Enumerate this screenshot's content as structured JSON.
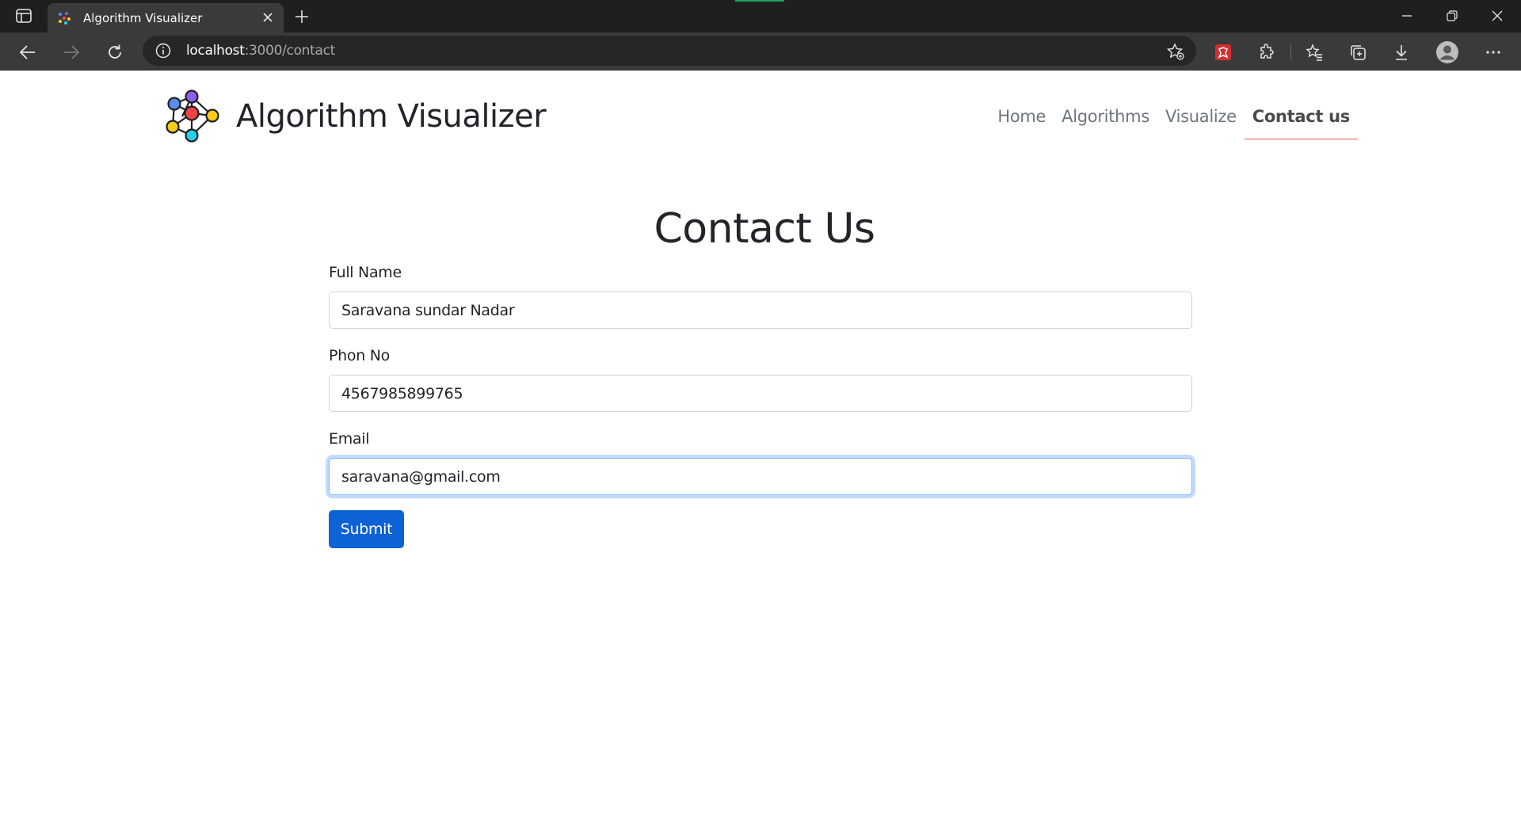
{
  "browser": {
    "tab_title": "Algorithm Visualizer",
    "url_host": "localhost",
    "url_path": ":3000/contact"
  },
  "site": {
    "brand": "Algorithm Visualizer",
    "nav": [
      {
        "label": "Home"
      },
      {
        "label": "Algorithms"
      },
      {
        "label": "Visualize"
      },
      {
        "label": "Contact us",
        "active": true
      }
    ]
  },
  "form": {
    "title": "Contact Us",
    "fields": [
      {
        "label": "Full Name",
        "value": "Saravana sundar Nadar"
      },
      {
        "label": "Phon No",
        "value": "4567985899765"
      },
      {
        "label": "Email",
        "value": "saravana@gmail.com",
        "focused": true
      }
    ],
    "submit_label": "Submit"
  },
  "colors": {
    "primary": "#0d62d6",
    "nav_active_underline": "#e05a4b",
    "focus_ring": "#86b7fe"
  }
}
